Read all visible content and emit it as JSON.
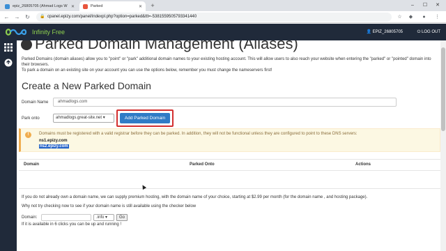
{
  "browser": {
    "tabs": [
      {
        "label": "epiz_26805705 (Ahmad Logs W"
      },
      {
        "label": "Parked"
      }
    ],
    "url": "cpanel.epizy.com/panel/indexpl.php?option=parked&ttt=-5381559505793341440"
  },
  "header": {
    "brand": "Infinity Free",
    "user": "EPIZ_26805705",
    "logout": "LOG OUT"
  },
  "page": {
    "title": "Parked Domain Management (Aliases)",
    "intro_1": "Parked Domains (domain aliases) allow you to \"point\" or \"park\" additional domain names to your existing hosting account. This will allow users to also reach your website when entering the \"parked\" or \"pointed\" domain into their browsers.",
    "intro_2": "To park a domain on an existing site on your account you can use the options below, remember you must change the nameservers first!",
    "section_title": "Create a New Parked Domain"
  },
  "form": {
    "domain_label": "Domain Name",
    "domain_value": "ahmadlogs.com",
    "park_label": "Park onto",
    "park_value": "ahmadlogs.great-site.net",
    "submit_label": "Add Parked Domain"
  },
  "alert": {
    "message": "Domains must be registered with a valid registrar before they can be parked. In addition, they will not be functional unless they are configured to point to these DNS servers:",
    "ns1": "ns1.epizy.com",
    "ns2": "ns2.epizy.com"
  },
  "table": {
    "columns": [
      "Domain",
      "Parked Onto",
      "Actions"
    ]
  },
  "footer": {
    "text_1": "If you do not already own a domain name, we can supply premium hosting, with the domain name of your choice, starting at $2.99 per month (for the domain name , and hosting package).",
    "text_2": "Why not try checking now to see if your domain name is still available using the checker below",
    "domain_label": "Domain:",
    "tld_value": ".info",
    "go_label": "Go",
    "text_3": "If it is available in 6 clicks you can be up and running !"
  }
}
